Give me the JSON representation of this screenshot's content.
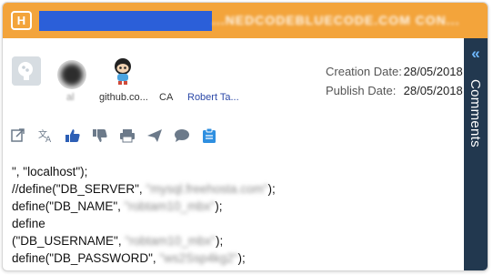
{
  "header": {
    "badge": "H",
    "title_blurred": "...NEDCODEBLUECODE.COM CON...",
    "accent": "#f3a43b",
    "redaction_color": "#2b5fd9"
  },
  "side_panel": {
    "toggle_glyph": "«",
    "label": "Comments",
    "color": "#22384f"
  },
  "meta": {
    "labels": [
      "al",
      "github.co...",
      "CA",
      "Robert Ta..."
    ],
    "icons": [
      "brain-avatar-icon",
      "user-avatar-icon",
      "octocat-icon"
    ]
  },
  "dates": {
    "creation_label": "Creation Date:",
    "creation_value": "28/05/2018",
    "publish_label": "Publish Date:",
    "publish_value": "28/05/2018"
  },
  "actions": [
    "share-icon",
    "translate-icon",
    "thumbs-up-icon",
    "thumbs-down-icon",
    "print-icon",
    "send-icon",
    "comment-icon",
    "clipboard-icon"
  ],
  "code": {
    "line1": "\", \"localhost\");",
    "line2_pre": "//define(\"DB_SERVER\", ",
    "line2_blur": "\"mysql.freehosta.com\"",
    "line2_post": ");",
    "line3_pre": "define(\"DB_NAME\", ",
    "line3_blur": "\"robtam10_mbx\"",
    "line3_post": ");",
    "line4": "define",
    "line5_pre": "(\"DB_USERNAME\", ",
    "line5_blur": "\"robtam10_mbx\"",
    "line5_post": ");",
    "line6_pre": "define(\"DB_PASSWORD\", ",
    "line6_blur": "\"ws2Ssp4kg2\"",
    "line6_post": ");"
  }
}
